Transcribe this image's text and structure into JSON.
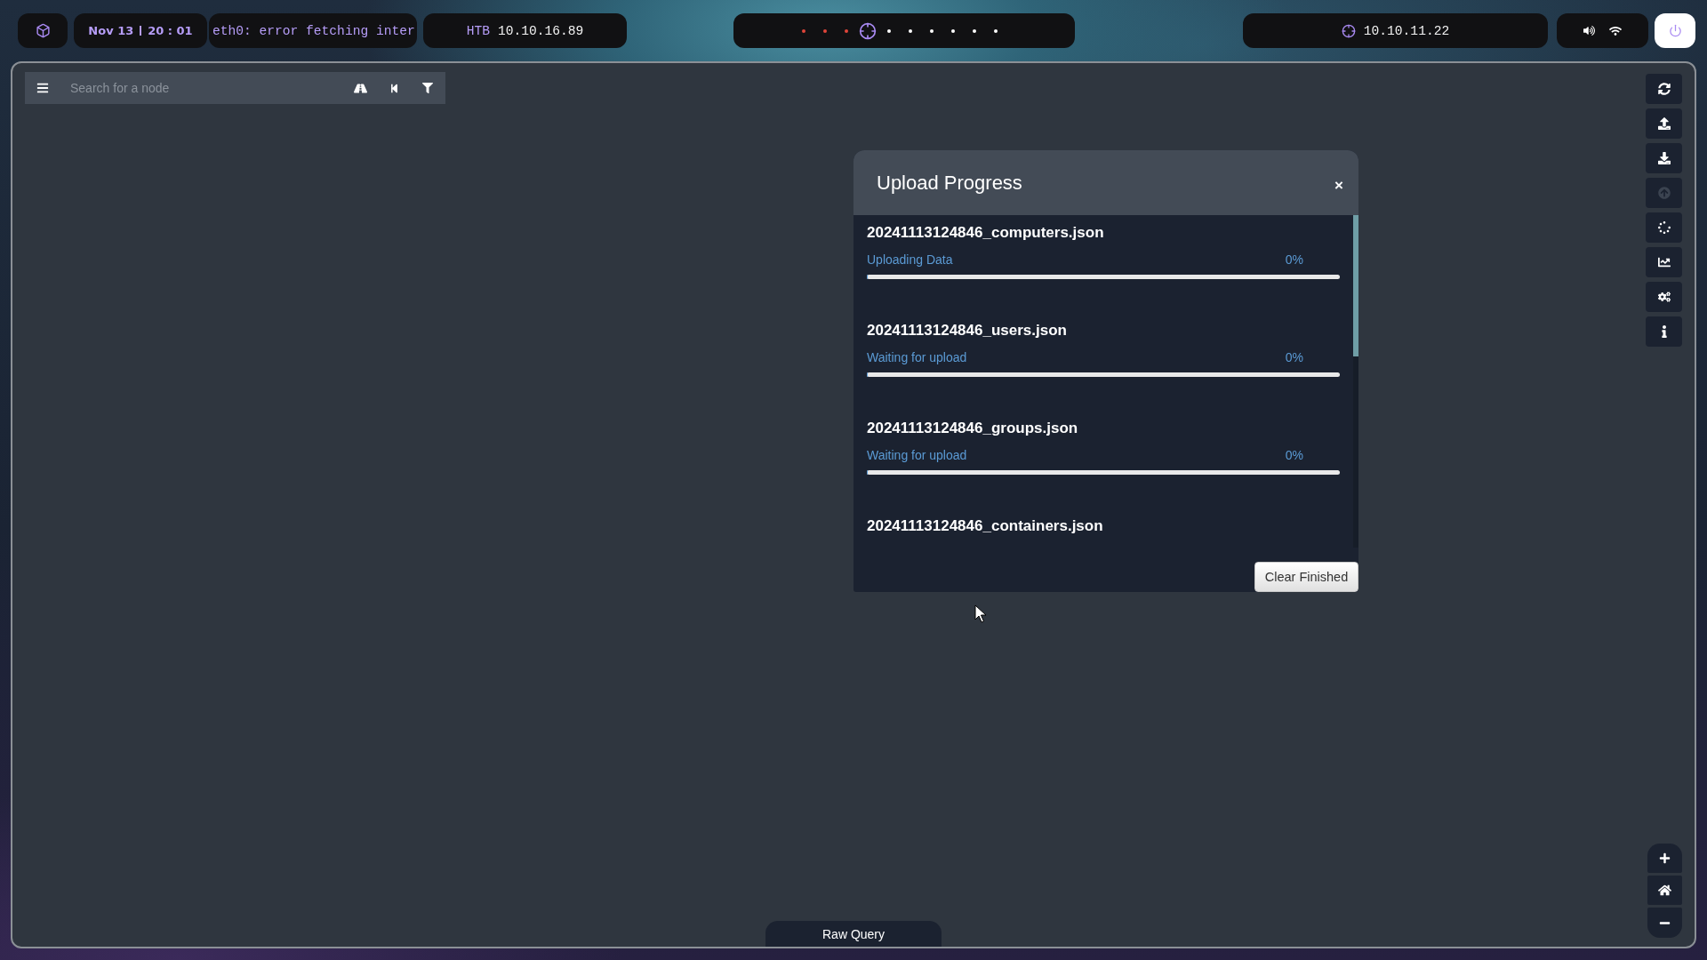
{
  "top_bar": {
    "clock": {
      "date": "Nov 13",
      "time": "20 : 01"
    },
    "network_status": "eth0: error fetching inter",
    "vpn": {
      "label": "HTB",
      "address": "10.10.16.89"
    },
    "workspaces": [
      {
        "selected": false,
        "color": "#e0453a"
      },
      {
        "selected": false,
        "color": "#e0453a"
      },
      {
        "selected": false,
        "color": "#e0453a"
      },
      {
        "selected": true
      },
      {
        "selected": false,
        "color": "#ffffff"
      },
      {
        "selected": false,
        "color": "#ffffff"
      },
      {
        "selected": false,
        "color": "#ffffff"
      },
      {
        "selected": false,
        "color": "#ffffff"
      },
      {
        "selected": false,
        "color": "#ffffff"
      },
      {
        "selected": false,
        "color": "#ffffff"
      }
    ],
    "target": {
      "address": "10.10.11.22"
    }
  },
  "search": {
    "placeholder": "Search for a node"
  },
  "toolbar": [
    {
      "kind": "refresh",
      "disabled": false
    },
    {
      "kind": "upload",
      "disabled": false
    },
    {
      "kind": "download",
      "disabled": false
    },
    {
      "kind": "upload-circle",
      "disabled": true
    },
    {
      "kind": "spinner",
      "disabled": false
    },
    {
      "kind": "chart",
      "disabled": false
    },
    {
      "kind": "settings",
      "disabled": false
    },
    {
      "kind": "info",
      "disabled": false
    }
  ],
  "upload_dialog": {
    "title": "Upload Progress",
    "close": "×",
    "files": [
      {
        "name": "20241113124846_computers.json",
        "status": "Uploading Data",
        "percent": "0%",
        "level": 0
      },
      {
        "name": "20241113124846_users.json",
        "status": "Waiting for upload",
        "percent": "0%",
        "level": 0
      },
      {
        "name": "20241113124846_groups.json",
        "status": "Waiting for upload",
        "percent": "0%",
        "level": 0
      },
      {
        "name": "20241113124846_containers.json"
      }
    ],
    "clear_button": "Clear Finished"
  },
  "raw_query": {
    "label": "Raw Query"
  }
}
